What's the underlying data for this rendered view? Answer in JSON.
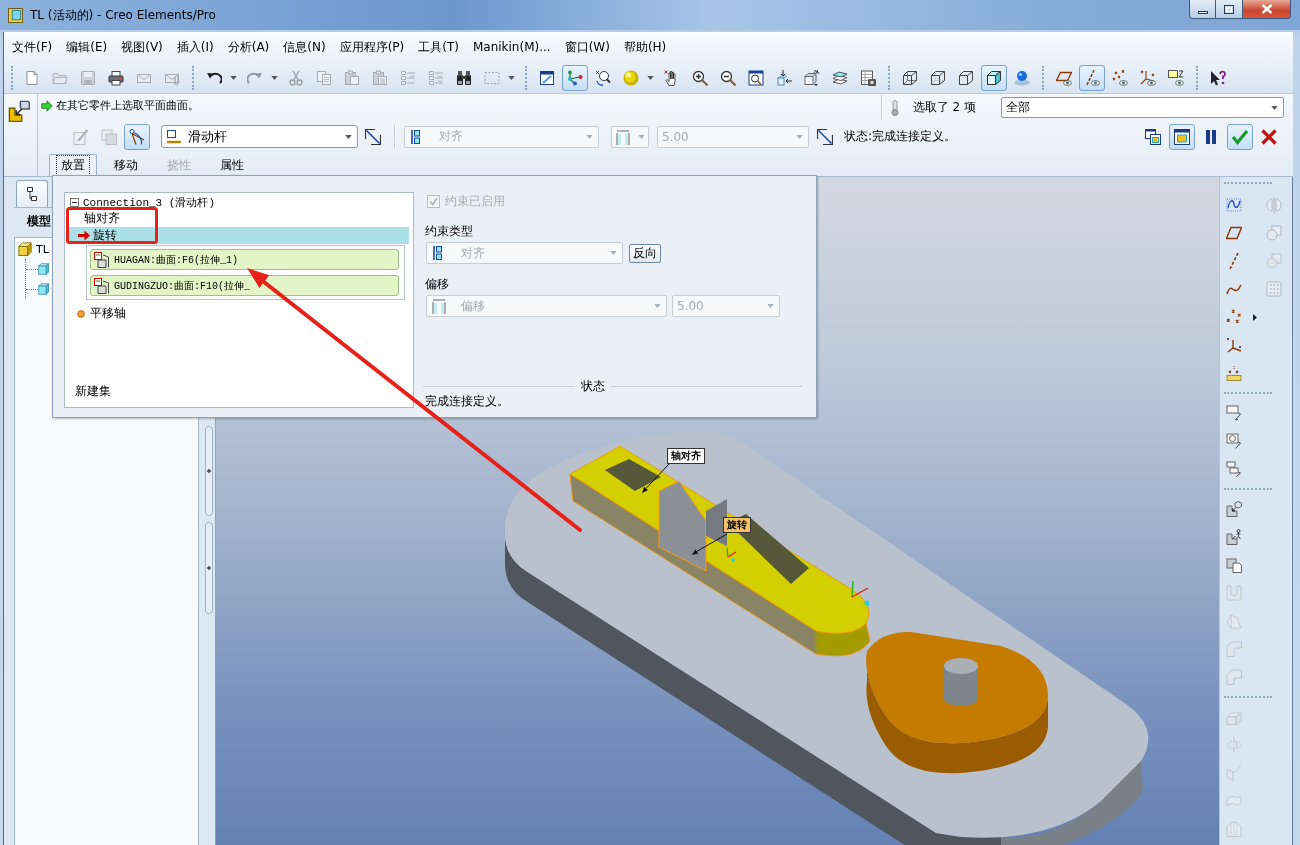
{
  "window": {
    "title": "TL (活动的) - Creo Elements/Pro"
  },
  "menu": [
    "文件(F)",
    "编辑(E)",
    "视图(V)",
    "插入(I)",
    "分析(A)",
    "信息(N)",
    "应用程序(P)",
    "工具(T)",
    "Manikin(M)...",
    "窗口(W)",
    "帮助(H)"
  ],
  "toolbar": [
    [
      {
        "kind": "new",
        "on": false,
        "disabled": false
      },
      {
        "kind": "open",
        "on": false,
        "disabled": true
      },
      {
        "kind": "save",
        "on": false,
        "disabled": true
      },
      {
        "kind": "print",
        "on": false,
        "disabled": false
      },
      {
        "kind": "mail",
        "on": false,
        "disabled": true
      },
      {
        "kind": "mail-attach",
        "on": false,
        "disabled": true
      }
    ],
    [
      {
        "kind": "undo",
        "on": false,
        "disabled": false,
        "dropdown": true
      },
      {
        "kind": "redo",
        "on": false,
        "disabled": true,
        "dropdown": true
      },
      {
        "kind": "cut",
        "on": false,
        "disabled": true
      },
      {
        "kind": "copy",
        "on": false,
        "disabled": true
      },
      {
        "kind": "paste",
        "on": false,
        "disabled": true
      },
      {
        "kind": "paste-special",
        "on": false,
        "disabled": true
      },
      {
        "kind": "regenerate",
        "on": false,
        "disabled": true
      },
      {
        "kind": "regen-manager",
        "on": false,
        "disabled": true
      },
      {
        "kind": "find",
        "on": false,
        "disabled": false
      },
      {
        "kind": "select-box",
        "on": false,
        "disabled": true,
        "dropdown": true
      }
    ],
    [
      {
        "kind": "repaint",
        "on": false,
        "disabled": false
      },
      {
        "kind": "spin-center",
        "on": true,
        "disabled": false
      },
      {
        "kind": "orient",
        "on": false,
        "disabled": false
      },
      {
        "kind": "appearance",
        "on": false,
        "disabled": false,
        "dropdown": true
      },
      {
        "kind": "pan",
        "on": false,
        "disabled": false
      },
      {
        "kind": "zoom-in",
        "on": false,
        "disabled": false
      },
      {
        "kind": "zoom-out",
        "on": false,
        "disabled": false
      },
      {
        "kind": "refit",
        "on": false,
        "disabled": false
      },
      {
        "kind": "reorient",
        "on": false,
        "disabled": false
      },
      {
        "kind": "saved-views",
        "on": false,
        "disabled": false
      },
      {
        "kind": "layers",
        "on": false,
        "disabled": false
      },
      {
        "kind": "view-manager",
        "on": false,
        "disabled": false
      }
    ],
    [
      {
        "kind": "wireframe",
        "on": false,
        "disabled": false
      },
      {
        "kind": "hidden-line",
        "on": false,
        "disabled": false
      },
      {
        "kind": "no-hidden",
        "on": false,
        "disabled": false
      },
      {
        "kind": "shaded",
        "on": true,
        "disabled": false
      },
      {
        "kind": "realism",
        "on": false,
        "disabled": false
      }
    ],
    [
      {
        "kind": "plane-display",
        "on": false,
        "disabled": false
      },
      {
        "kind": "axis-display",
        "on": true,
        "disabled": false
      },
      {
        "kind": "point-display",
        "on": false,
        "disabled": false
      },
      {
        "kind": "csys-display",
        "on": false,
        "disabled": false
      },
      {
        "kind": "note-display",
        "on": false,
        "disabled": false
      }
    ],
    [
      {
        "kind": "whats-this",
        "on": false,
        "disabled": false
      }
    ]
  ],
  "dashboard": {
    "prompt": "在其它零件上选取平面曲面。",
    "selection_count": "选取了 2 项",
    "filter": "全部",
    "tools": [
      {
        "kind": "edit-sketch",
        "on": false,
        "disabled": true
      },
      {
        "kind": "copy-geometry",
        "on": false,
        "disabled": true
      },
      {
        "kind": "user-connection",
        "on": true,
        "disabled": false
      }
    ],
    "connection_type": "滑动杆",
    "constraint_type": {
      "value": "对齐",
      "disabled": true
    },
    "offset_type": {
      "disabled": true
    },
    "offset": {
      "value": "5.00",
      "disabled": true
    },
    "status": "状态:完成连接定义。",
    "window_modes": [
      {
        "kind": "separate-window",
        "on": false
      },
      {
        "kind": "assembly-window",
        "on": true
      }
    ],
    "actions": [
      {
        "kind": "pause",
        "on": false
      },
      {
        "kind": "apply",
        "on": true
      },
      {
        "kind": "cancel",
        "on": false
      }
    ],
    "tabs": [
      {
        "label": "放置",
        "selected": true,
        "disabled": false
      },
      {
        "label": "移动",
        "selected": false,
        "disabled": false
      },
      {
        "label": "挠性",
        "selected": false,
        "disabled": true
      },
      {
        "label": "属性",
        "selected": false,
        "disabled": false
      }
    ]
  },
  "model_tree": {
    "tabs": [
      {
        "kind": "model-tree",
        "selected": true
      }
    ],
    "title": "模型",
    "items": [
      {
        "label": "TL",
        "kind": "assembly",
        "children": [
          {
            "kind": "part"
          },
          {
            "kind": "part"
          }
        ]
      }
    ]
  },
  "placement": {
    "connection": {
      "label": "Connection_3 (滑动杆)",
      "expanded": true
    },
    "constraints": [
      {
        "label": "轴对齐",
        "kind": "defined",
        "selected": false
      },
      {
        "label": "旋转",
        "kind": "active",
        "selected": true,
        "references": [
          "HUAGAN:曲面:F6(拉伸_1)",
          "GUDINGZUO:曲面:F10(拉伸_"
        ]
      },
      {
        "label": "平移轴",
        "kind": "incomplete",
        "selected": false
      }
    ],
    "new_set": "新建集",
    "enabled": {
      "label": "约束已启用",
      "checked": true,
      "disabled": true
    },
    "constraint_type": {
      "label": "约束类型",
      "value": "对齐",
      "disabled": true
    },
    "flip": "反向",
    "offset": {
      "label": "偏移",
      "type": "偏移",
      "value": "5.00",
      "disabled": true
    },
    "status": {
      "label": "状态",
      "text": "完成连接定义。"
    }
  },
  "viewport": {
    "labels": [
      {
        "text": "轴对齐",
        "kind": "plain"
      },
      {
        "text": "旋转",
        "kind": "highlight"
      }
    ]
  },
  "right_toolbar": [
    [
      [
        {
          "kind": "sketch",
          "disabled": false
        },
        {
          "kind": "mirror",
          "disabled": true
        }
      ],
      [
        {
          "kind": "datum-plane",
          "disabled": false
        },
        {
          "kind": "merge",
          "disabled": true
        }
      ],
      [
        {
          "kind": "datum-axis",
          "disabled": false
        },
        {
          "kind": "intersect",
          "disabled": true
        }
      ],
      [
        {
          "kind": "datum-curve",
          "disabled": false
        },
        {
          "kind": "pattern",
          "disabled": true
        }
      ],
      [
        {
          "kind": "datum-point",
          "disabled": false,
          "flyout": true
        }
      ],
      [
        {
          "kind": "csys",
          "disabled": false
        }
      ],
      [
        {
          "kind": "analysis",
          "disabled": false
        }
      ]
    ],
    [
      [
        {
          "kind": "note-leader",
          "disabled": false
        }
      ],
      [
        {
          "kind": "note-symbol",
          "disabled": false
        }
      ],
      [
        {
          "kind": "note-stack",
          "disabled": false
        }
      ]
    ],
    [
      [
        {
          "kind": "assemble",
          "disabled": false
        }
      ],
      [
        {
          "kind": "assemble-person",
          "disabled": false
        }
      ],
      [
        {
          "kind": "new-component",
          "disabled": false
        }
      ],
      [
        {
          "kind": "slot",
          "disabled": true
        }
      ],
      [
        {
          "kind": "draft",
          "disabled": true
        }
      ],
      [
        {
          "kind": "round",
          "disabled": true
        }
      ],
      [
        {
          "kind": "chamfer",
          "disabled": true
        }
      ]
    ],
    [
      [
        {
          "kind": "extrude",
          "disabled": true
        }
      ],
      [
        {
          "kind": "revolve",
          "disabled": true
        }
      ],
      [
        {
          "kind": "sweep",
          "disabled": true
        }
      ],
      [
        {
          "kind": "blend",
          "disabled": true
        }
      ],
      [
        {
          "kind": "boundary",
          "disabled": true
        }
      ]
    ]
  ]
}
